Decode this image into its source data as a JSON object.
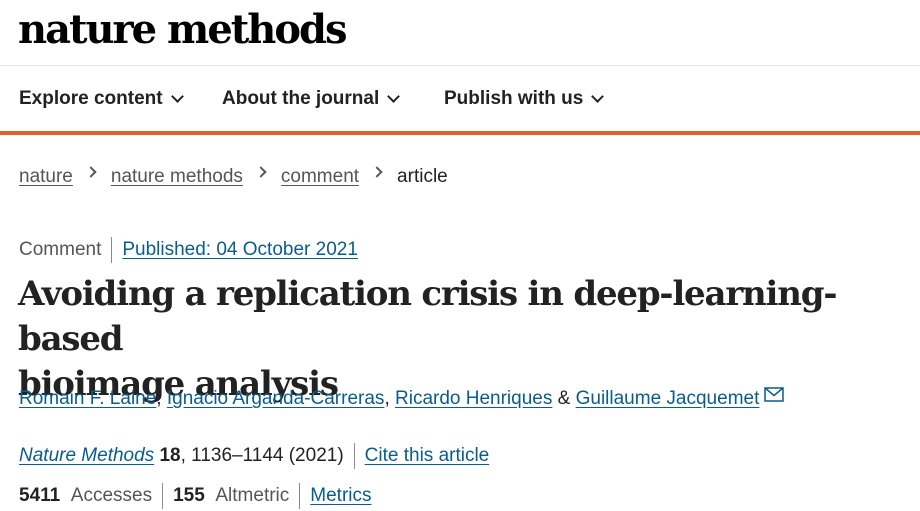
{
  "site": {
    "logo_text": "nature methods"
  },
  "nav": {
    "items": [
      {
        "label": "Explore content"
      },
      {
        "label": "About the journal"
      },
      {
        "label": "Publish with us"
      }
    ]
  },
  "breadcrumb": {
    "items": [
      {
        "label": "nature"
      },
      {
        "label": "nature methods"
      },
      {
        "label": "comment"
      }
    ],
    "current": "article"
  },
  "article": {
    "type": "Comment",
    "published": "Published: 04 October 2021",
    "title_line1": "Avoiding a replication crisis in deep-learning-based",
    "title_line2": "bioimage analysis",
    "authors": [
      "Romain F. Laine",
      "Ignacio Arganda-Carreras",
      "Ricardo Henriques",
      "Guillaume Jacquemet"
    ],
    "author_sep": ",",
    "author_and": "&",
    "citation": {
      "journal": "Nature Methods",
      "volume": "18",
      "pages": ", 1136–1144 (2021)",
      "cite_label": "Cite this article"
    },
    "metrics": {
      "accesses_value": "5411",
      "accesses_label": "Accesses",
      "altmetric_value": "155",
      "altmetric_label": "Altmetric",
      "metrics_label": "Metrics"
    }
  },
  "colors": {
    "accent": "#e0602a",
    "link": "#0a5d8a"
  }
}
